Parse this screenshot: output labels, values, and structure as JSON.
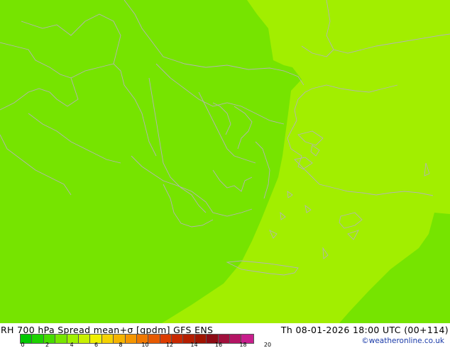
{
  "title": "RH 700 hPa Spread mean+σ [gpdm] GFS ENS",
  "datetime": "Th 08-01-2026 18:00 UTC (00+114)",
  "credit": "©weatheronline.co.uk",
  "colors": {
    "field_low": "#76e400",
    "field_high": "#a2ee00",
    "border": "#b4b4b4",
    "credit": "#1a3aa8"
  },
  "legend": {
    "swatches": [
      "#00c800",
      "#1ed200",
      "#46dc00",
      "#78e600",
      "#a0f000",
      "#c8f000",
      "#f0f000",
      "#f5d200",
      "#f5b400",
      "#f59600",
      "#f07800",
      "#e65a00",
      "#dc3c00",
      "#c82800",
      "#b41e00",
      "#a01400",
      "#8c0a14",
      "#a0103c",
      "#b41464",
      "#c81e8c"
    ],
    "ticks": [
      "0",
      "2",
      "4",
      "6",
      "8",
      "10",
      "12",
      "14",
      "16",
      "18",
      "20"
    ]
  }
}
